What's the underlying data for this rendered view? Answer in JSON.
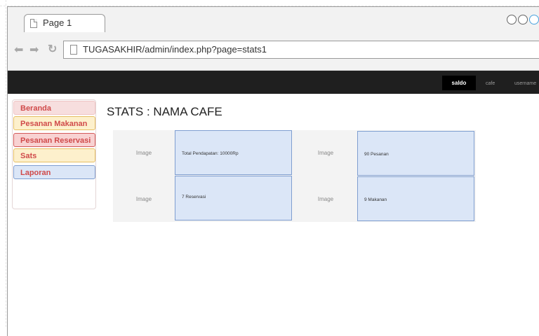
{
  "browser": {
    "tab_title": "Page 1",
    "url": "TUGASAKHIR/admin/index.php?page=stats1",
    "back_icon": "arrow-left-icon",
    "forward_icon": "arrow-right-icon",
    "reload_icon": "reload-icon"
  },
  "topbar": {
    "items": [
      "saldo",
      "cafe",
      "username"
    ],
    "active": "saldo"
  },
  "sidebar": {
    "items": [
      {
        "label": "Beranda"
      },
      {
        "label": "Pesanan Makanan"
      },
      {
        "label": "Pesanan Reservasi"
      },
      {
        "label": "Sats"
      },
      {
        "label": "Laporan"
      }
    ]
  },
  "main": {
    "title": "STATS : NAMA CAFE",
    "cards": [
      {
        "image_label": "Image",
        "value": "Total Pendapatan: 10000Rp"
      },
      {
        "image_label": "Image",
        "value": "90 Pesanan"
      },
      {
        "image_label": "Image",
        "value": "7 Reservasi"
      },
      {
        "image_label": "Image",
        "value": "9 Makanan"
      }
    ]
  },
  "colors": {
    "topbar_bg": "#1f1f1f",
    "card_value_bg": "#dbe6f7",
    "card_value_border": "#7f9ed0",
    "sidebar_text": "#d04a4a"
  }
}
